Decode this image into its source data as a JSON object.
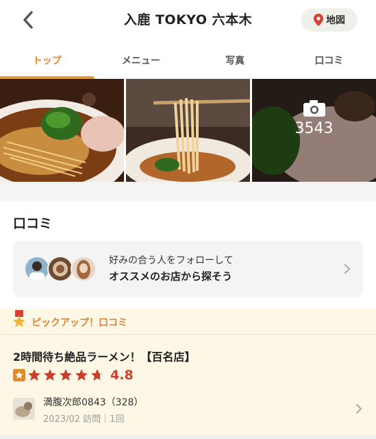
{
  "header": {
    "title": "入鹿 TOKYO 六本木",
    "map_label": "地図"
  },
  "tabs": [
    {
      "label": "トップ",
      "active": true
    },
    {
      "label": "メニュー",
      "active": false
    },
    {
      "label": "写真",
      "active": false
    },
    {
      "label": "口コミ",
      "active": false
    }
  ],
  "photos": {
    "count": "3543"
  },
  "reviews_section": {
    "title": "口コミ",
    "follow_line1": "好みの合う人をフォローして",
    "follow_line2": "オススメのお店から探そう"
  },
  "pickup": {
    "label": "ピックアップ！口コミ",
    "review_title": "2時間待ち絶品ラーメン！【百名店】",
    "rating": "4.8",
    "stars": 4.8,
    "reviewer_name": "満腹次郎0843（328）",
    "visit_info": "2023/02 訪問｜1回"
  },
  "colors": {
    "accent": "#e3892c",
    "rating": "#c8412f",
    "pickup_bg": "#fdf7e6"
  }
}
